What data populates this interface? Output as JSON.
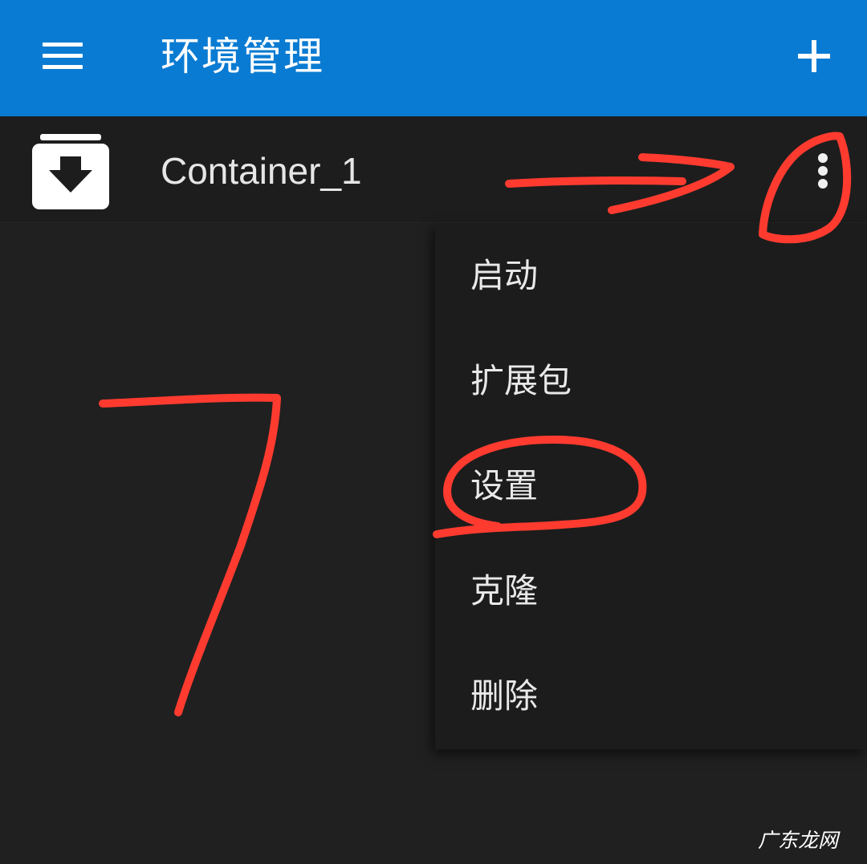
{
  "app_bar": {
    "menu_icon": "hamburger-menu-icon",
    "title": "环境管理",
    "add_icon": "plus-icon",
    "color": "#0a7bd2"
  },
  "containers": [
    {
      "icon": "archive-download-icon",
      "name": "Container_1",
      "overflow_icon": "more-vertical-icon"
    }
  ],
  "context_menu": {
    "items": [
      {
        "label": "启动"
      },
      {
        "label": "扩展包"
      },
      {
        "label": "设置"
      },
      {
        "label": "克隆"
      },
      {
        "label": "删除"
      }
    ]
  },
  "annotation": {
    "handwritten_number": "7",
    "color": "#ff3b30"
  },
  "watermark": "广东龙网"
}
